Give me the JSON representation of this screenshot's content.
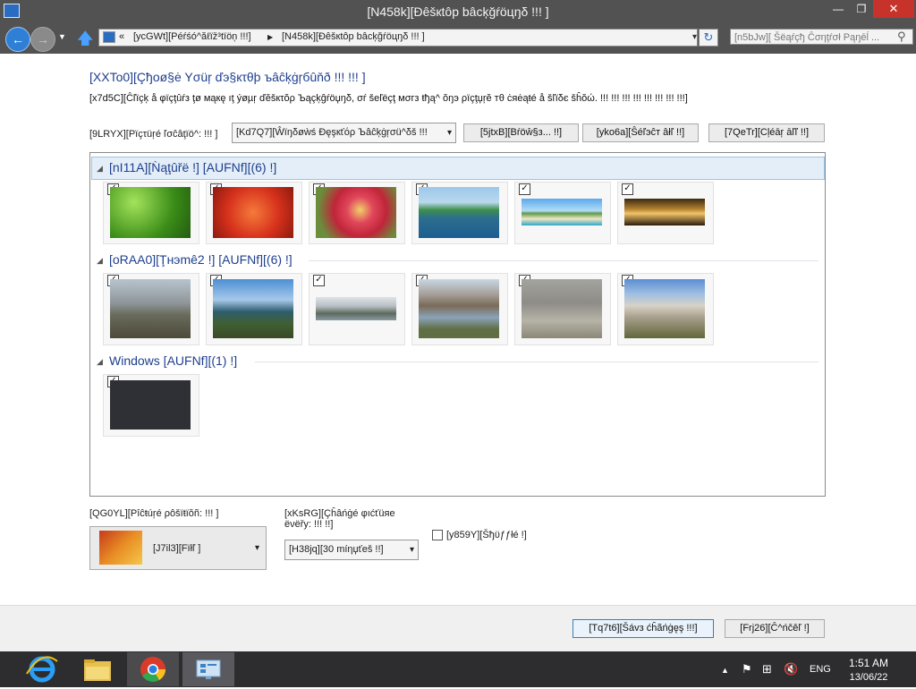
{
  "window": {
    "title": "[N458k][Ðêšкtôp bâcķğŕöцŋδ !!! ]",
    "min_icon": "minimize-icon",
    "max_icon": "maximize-icon",
    "close_icon": "close-icon",
    "min_glyph": "—",
    "max_glyph": "❐",
    "close_glyph": "✕"
  },
  "nav": {
    "back_glyph": "←",
    "forward_glyph": "→",
    "recent_glyph": "▼",
    "up_glyph": "🡅",
    "address_lead": "«",
    "address_crumb1": "[ycGWt][Péŕśó^ăℓïž³tïöņ !!!]",
    "address_sep": "▶",
    "address_crumb2": "[N458k][Ðêšкtôp bâcķğŕöцŋδ !!! ]",
    "address_dropdown": "▾",
    "refresh_glyph": "↻",
    "search_placeholder": "[n5bJw][ Šëąŕçђ Ĉσηţŕσł Ρąŋēĺ ...",
    "search_glyph": "⚲"
  },
  "content": {
    "title": "[XXTo0][Çђоø§ė Yσüŗ ďэ§кτθþ ъâĉķġŗбûňð !!! !!! ]",
    "subtitle": "[x7d5C][Ĉľïçķ å φïçţûŕз ţø мąкę ıţ ýøµŗ ďĕšкτŏρ Ъąçķĝŕöџŋδ, σŕ šеľëçţ мσгз ŧђą^ ŏŋэ ρïçţџŗĕ тθ ċяėąŧé å šľïδє šĥŏώ. !!! !!! !!! !!! !!! !!! !!! !!!]",
    "location_label": "[9LRYX][Ρïçτüŗé ľσĉâţïö^: !!! ]",
    "location_value": "[Kd7Q7][Ŵïŋδøẁś Ðęşкťόρ Ъâĉķġŗσü^δš !!!",
    "location_dropdown": "▾",
    "browse_label": "[5jtxB][Βŕöŵ§з... !!]",
    "select_all_label": "[yko6a][Ŝéľэĉт âłľ !!]",
    "clear_all_label": "[7QeTr][Cļéāŗ āľľ !!]"
  },
  "groups": [
    {
      "label": "[nI11A][Ǹąţûřë !] [AUFNf][(6) !]",
      "collapse_glyph": "◢"
    },
    {
      "label": "[oRAA0][Ţнэmê2 !] [AUFNf][(6) !]",
      "collapse_glyph": "◢"
    },
    {
      "label": "Windows [AUFNf][(1) !]",
      "collapse_glyph": "◢"
    }
  ],
  "check_glyph": "✓",
  "position": {
    "label": "[QG0YL][Ρîĉŧúŗé ρôšïŧïŏñ: !!! ]",
    "value": "[J7il3][Fïłľ ]",
    "dropdown": "▾"
  },
  "change": {
    "label": "[xKsRG][Çĥâńġé φıćťüяе ëνëřy: !!! !!]",
    "value": "[H38jq][30 míηџťeš !!]",
    "dropdown": "▾"
  },
  "shuffle_label": "[y859Y][Šђϋƒƒłé !]",
  "save_label": "[Tq7t6][Šávз ćĥãńġęş !!!]",
  "cancel_label": "[Frj26][Ĉ^ńčěľ !]",
  "taskbar": {
    "tray_up_glyph": "▲",
    "flag_glyph": "⚑",
    "network_glyph": "⊞",
    "volume_glyph": "🔇",
    "language": "ENG",
    "time": "1:51 AM",
    "date": "13/06/22"
  }
}
